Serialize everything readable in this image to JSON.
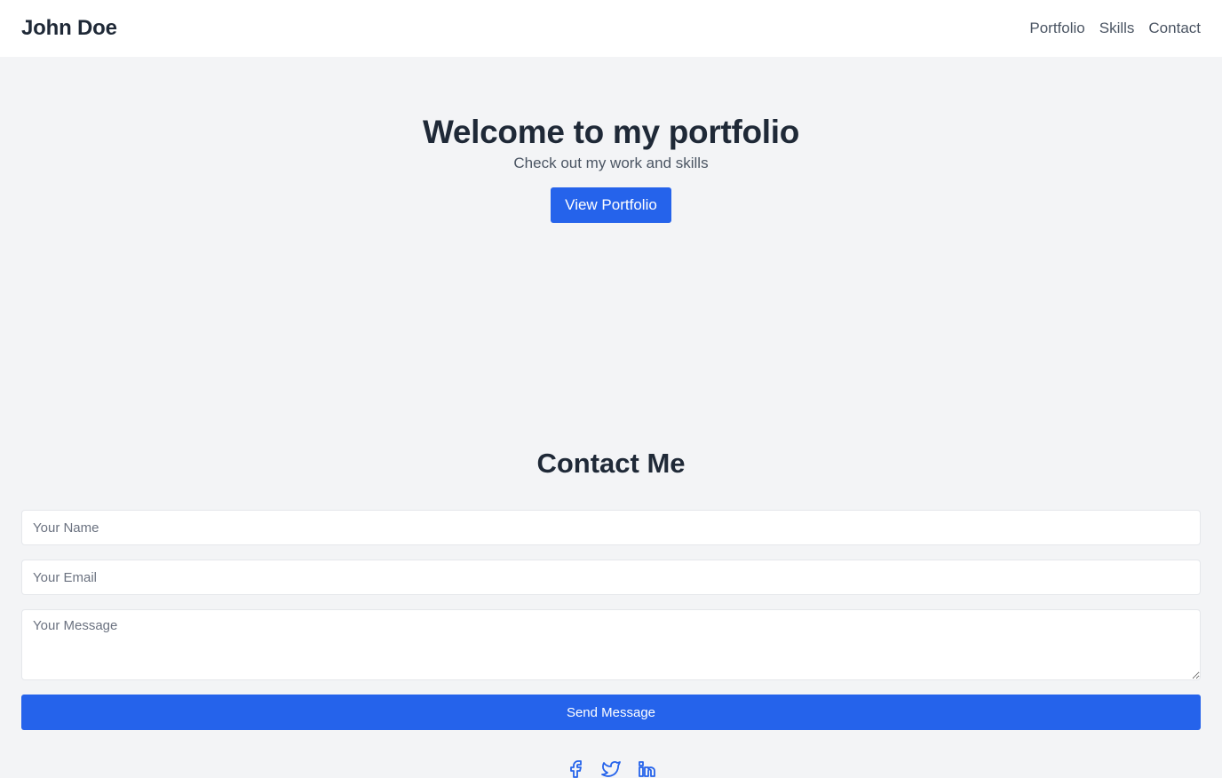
{
  "header": {
    "brand": "John Doe",
    "nav": [
      {
        "label": "Portfolio"
      },
      {
        "label": "Skills"
      },
      {
        "label": "Contact"
      }
    ]
  },
  "hero": {
    "title": "Welcome to my portfolio",
    "subtitle": "Check out my work and skills",
    "button_label": "View Portfolio"
  },
  "contact": {
    "title": "Contact Me",
    "name_placeholder": "Your Name",
    "email_placeholder": "Your Email",
    "message_placeholder": "Your Message",
    "send_label": "Send Message"
  },
  "socials": [
    {
      "icon": "facebook-icon"
    },
    {
      "icon": "twitter-icon"
    },
    {
      "icon": "linkedin-icon"
    }
  ],
  "colors": {
    "accent": "#2563eb",
    "background": "#f3f4f6",
    "text": "#1f2937",
    "muted": "#4b5563"
  }
}
